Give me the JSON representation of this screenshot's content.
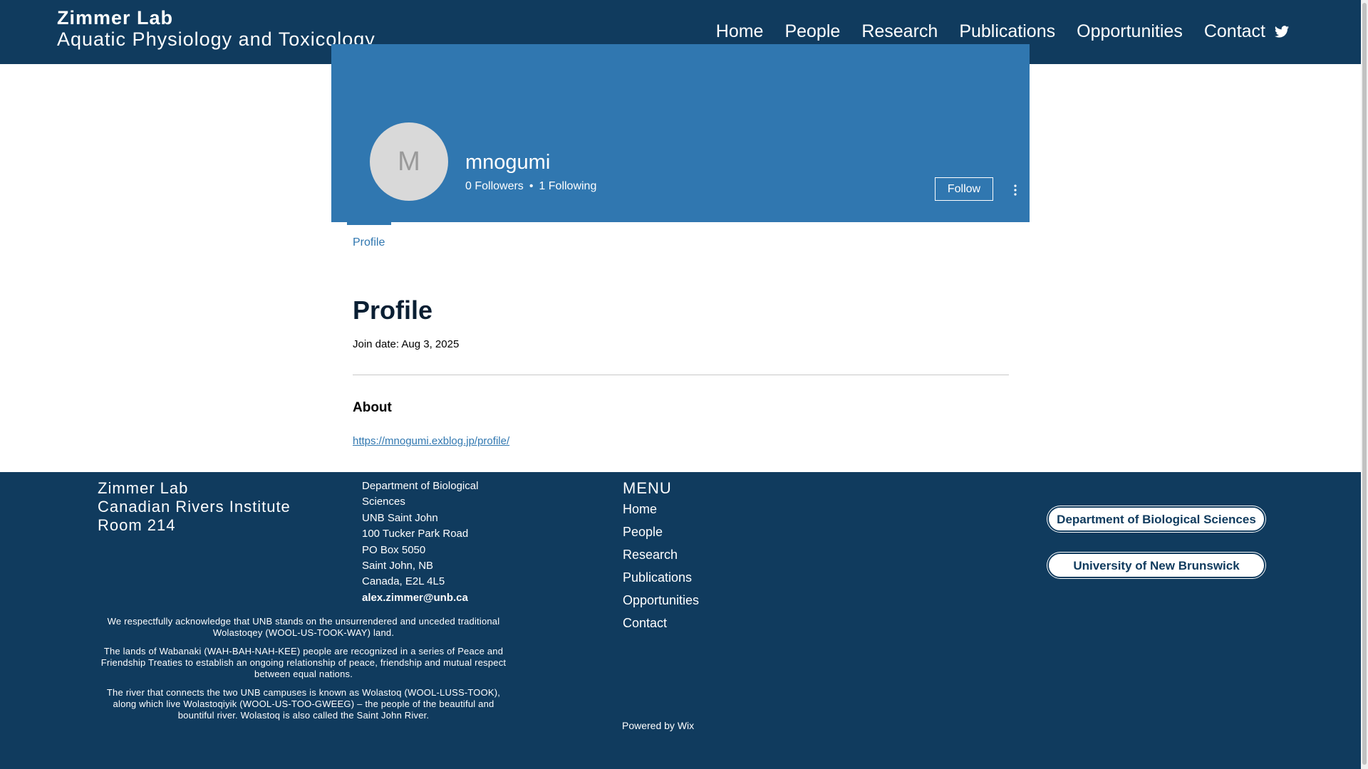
{
  "header": {
    "lab_name": "Zimmer Lab",
    "subtitle": "Aquatic Physiology and Toxicology",
    "nav": [
      "Home",
      "People",
      "Research",
      "Publications",
      "Opportunities",
      "Contact"
    ],
    "social_icon": "twitter-icon"
  },
  "profile": {
    "avatar_initial": "M",
    "username": "mnogumi",
    "followers": "0 Followers",
    "separator": "•",
    "following": "1 Following",
    "follow_label": "Follow",
    "tab_label": "Profile",
    "section_title": "Profile",
    "join_date": "Join date: Aug 3, 2025",
    "about_title": "About",
    "about_link": "https://mnogumi.exblog.jp/profile/"
  },
  "footer": {
    "lab_lines": [
      "Zimmer Lab",
      "Canadian Rivers Institute",
      "Room 214"
    ],
    "address_lines": [
      "Department of Biological Sciences",
      "UNB Saint John",
      "100 Tucker Park Road",
      "PO Box 5050",
      "Saint John, NB",
      "Canada, E2L 4L5"
    ],
    "email": "alex.zimmer@unb.ca",
    "acknowledgement": [
      "We respectfully acknowledge that UNB stands on the unsurrendered and unceded traditional Wolastoqey (WOOL-US-TOOK-WAY) land.",
      "The lands of Wabanaki (WAH-BAH-NAH-KEE) people are recognized in a series of Peace and Friendship Treaties to establish an ongoing relationship of peace, friendship and mutual respect between equal nations.",
      "The river that connects the two UNB campuses is known as Wolastoq (WOOL-LUSS-TOOK), along which live Wolastoqiyik (WOOL-US-TOO-GWEEG) – the people of the beautiful and bountiful river. Wolastoq is also called the Saint John River."
    ],
    "menu_title": "MENU",
    "menu_items": [
      "Home",
      "People",
      "Research",
      "Publications",
      "Opportunities",
      "Contact"
    ],
    "button_dept": "Department of Biological Sciences",
    "button_unb": "University of New Brunswick",
    "powered_by": "Powered by Wix"
  },
  "colors": {
    "navy": "#103b5e",
    "cover_blue": "#3077b0",
    "white": "#ffffff"
  }
}
